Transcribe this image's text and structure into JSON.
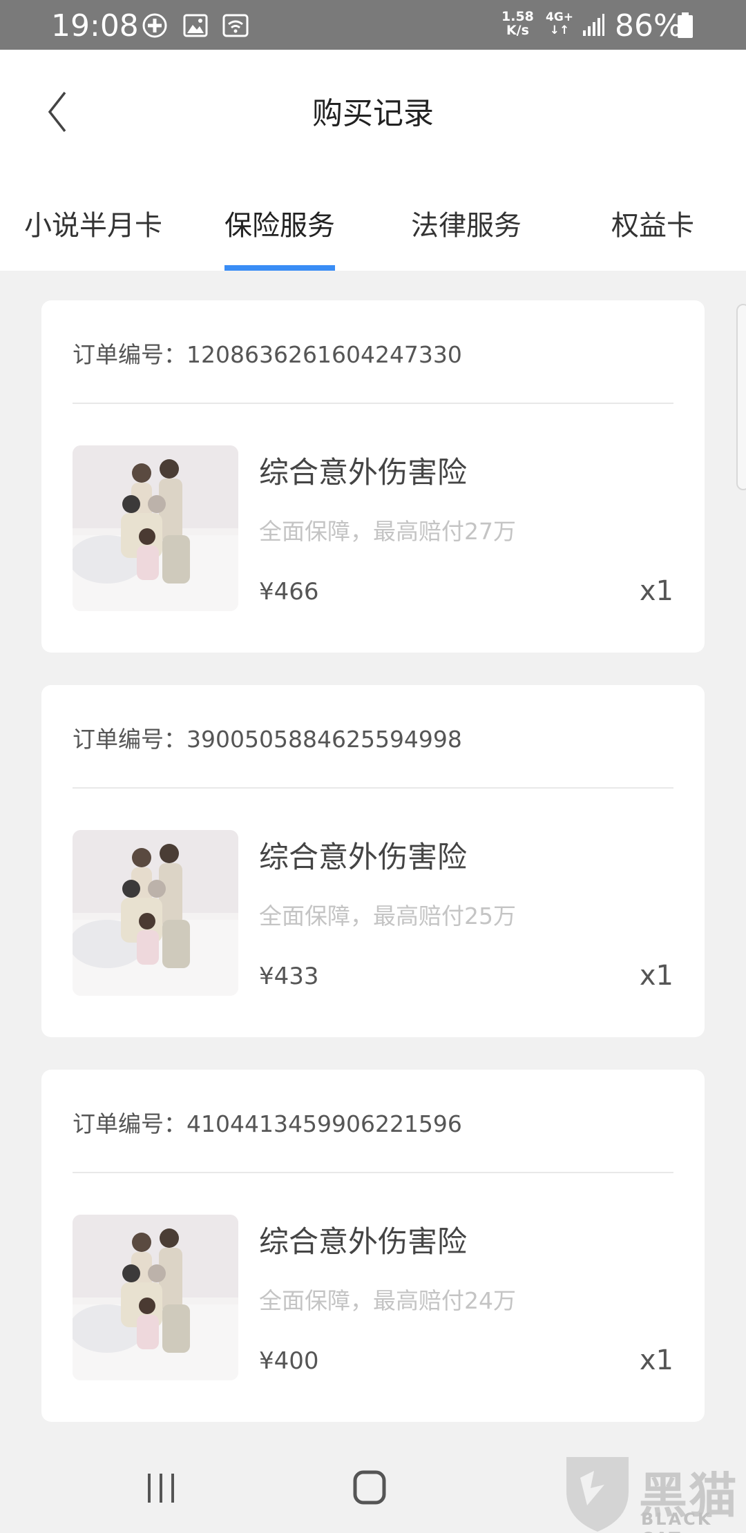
{
  "status_bar": {
    "time": "19:08",
    "speed_value": "1.58",
    "speed_unit": "K/s",
    "network": "4G+",
    "battery": "86%",
    "icons": [
      "add-circle-icon",
      "image-icon",
      "wifi-icon",
      "signal-icon",
      "battery-icon"
    ]
  },
  "header": {
    "title": "购买记录",
    "back_icon": "back-arrow-icon"
  },
  "tabs": [
    {
      "label": "小说半月卡",
      "active": false
    },
    {
      "label": "保险服务",
      "active": true
    },
    {
      "label": "法律服务",
      "active": false
    },
    {
      "label": "权益卡",
      "active": false
    }
  ],
  "colors": {
    "accent": "#3a8df5",
    "background": "#f1f1f1",
    "status_bar": "#7a7a7a"
  },
  "orders": [
    {
      "order_no": "订单编号：1208636261604247330",
      "product_name": "综合意外伤害险",
      "description": "全面保障，最高赔付27万",
      "price": "¥466",
      "quantity": "x1"
    },
    {
      "order_no": "订单编号：3900505884625594998",
      "product_name": "综合意外伤害险",
      "description": "全面保障，最高赔付25万",
      "price": "¥433",
      "quantity": "x1"
    },
    {
      "order_no": "订单编号：4104413459906221596",
      "product_name": "综合意外伤害险",
      "description": "全面保障，最高赔付24万",
      "price": "¥400",
      "quantity": "x1"
    }
  ],
  "nav_bar": {
    "icons": [
      "recent-apps-icon",
      "home-icon",
      "back-icon"
    ]
  },
  "watermark": {
    "text": "黑猫",
    "sub": "BLACK CAT"
  }
}
